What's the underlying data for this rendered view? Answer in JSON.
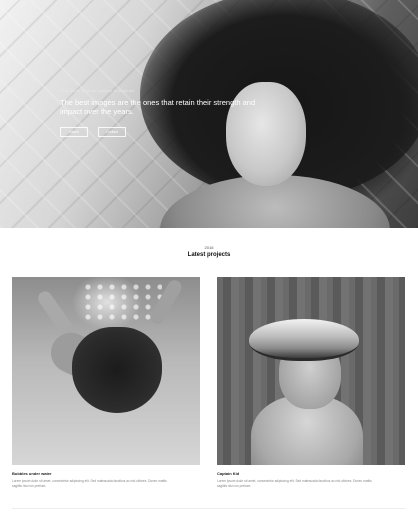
{
  "hero": {
    "kicker": "This photo editorial gallery is inspired",
    "headline": "The best images are the ones that retain their strength and impact over the years.",
    "buttons": [
      "About",
      "Contact"
    ]
  },
  "section": {
    "year": "2016",
    "title": "Latest projects"
  },
  "projects": [
    {
      "title": "Bubbles under water",
      "description": "Lorem ipsum dolor sit amet, consectetur adipiscing elit. Sed malesuada faucibus ac nisi ultrices. Donec mattis sagittis nisi non pretium."
    },
    {
      "title": "Captain Kid",
      "description": "Lorem ipsum dolor sit amet, consectetur adipiscing elit. Sed malesuada faucibus ac nisi ultrices. Donec mattis sagittis nisi non pretium."
    }
  ]
}
